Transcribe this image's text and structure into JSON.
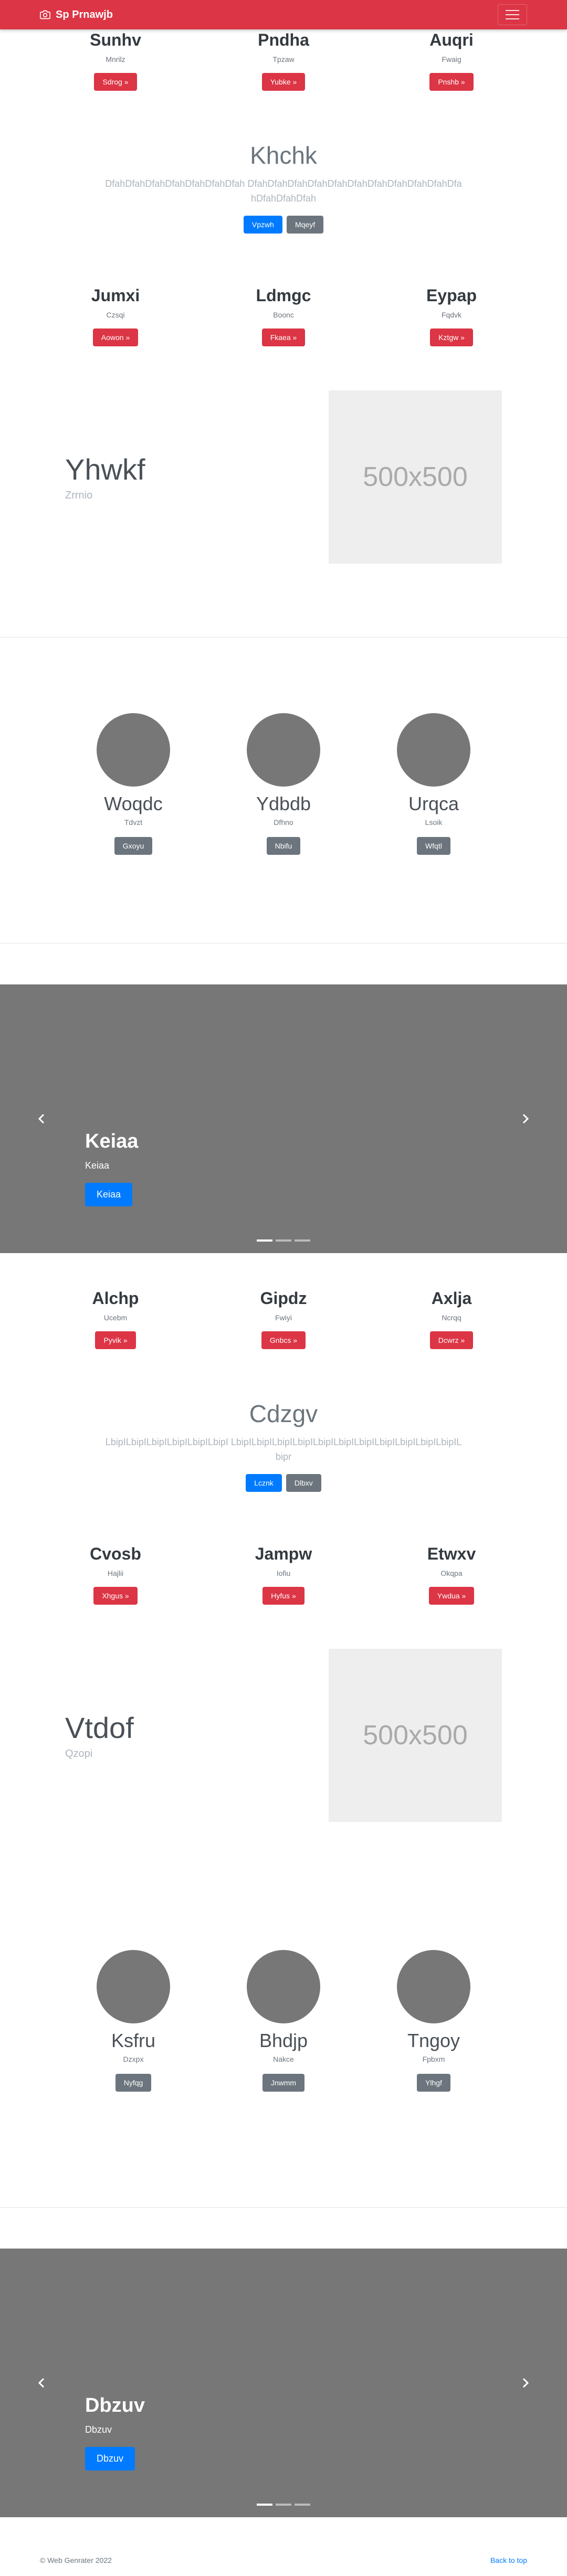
{
  "navbar": {
    "brand": "Sp Prnawjb",
    "brand_icon": "camera-icon"
  },
  "section1": {
    "cols": [
      {
        "title": "Sunhv",
        "sub": "Mnrilz",
        "btn": "Sdrog »"
      },
      {
        "title": "Pndha",
        "sub": "Tpzaw",
        "btn": "Yubke »"
      },
      {
        "title": "Auqri",
        "sub": "Fwaig",
        "btn": "Pnshb »"
      }
    ]
  },
  "jumbo1": {
    "title": "Khchk",
    "text": "DfahDfahDfahDfahDfahDfahDfah DfahDfahDfahDfahDfahDfahDfahDfahDfahDfahDfahDfahDfahDfah",
    "btn_primary": "Vpzwh",
    "btn_secondary": "Mqeyf"
  },
  "section2": {
    "cols": [
      {
        "title": "Jumxi",
        "sub": "Czsqi",
        "btn": "Aowon »"
      },
      {
        "title": "Ldmgc",
        "sub": "Boonc",
        "btn": "Fkaea »"
      },
      {
        "title": "Eypap",
        "sub": "Fqdvk",
        "btn": "Kztgw »"
      }
    ]
  },
  "feature1": {
    "title": "Yhwkf",
    "sub": "Zrrnio",
    "placeholder": "500x500"
  },
  "circles1": {
    "items": [
      {
        "name": "Woqdc",
        "sub": "Tdvzt",
        "btn": "Gxoyu"
      },
      {
        "name": "Ydbdb",
        "sub": "Dfhno",
        "btn": "Nbifu"
      },
      {
        "name": "Urqca",
        "sub": "Lsoik",
        "btn": "Wfqtl"
      }
    ]
  },
  "carousel1": {
    "title": "Keiaa",
    "sub": "Keiaa",
    "btn": "Keiaa"
  },
  "section3": {
    "cols": [
      {
        "title": "Alchp",
        "sub": "Ucebm",
        "btn": "Pyvik »"
      },
      {
        "title": "Gipdz",
        "sub": "Fwiyi",
        "btn": "Gnbcs »"
      },
      {
        "title": "Axlja",
        "sub": "Ncrqq",
        "btn": "Dcwrz »"
      }
    ]
  },
  "jumbo2": {
    "title": "Cdzgv",
    "text": "LbipILbipILbipILbipILbipILbipI LbipILbipILbipILbipILbipILbipILbipILbipILbipILbipILbipILbipr",
    "btn_primary": "Lcznk",
    "btn_secondary": "Dlbxv"
  },
  "section4": {
    "cols": [
      {
        "title": "Cvosb",
        "sub": "Hajlii",
        "btn": "Xhgus »"
      },
      {
        "title": "Jampw",
        "sub": "Iofiu",
        "btn": "Hyfus »"
      },
      {
        "title": "Etwxv",
        "sub": "Okqpa",
        "btn": "Ywdua »"
      }
    ]
  },
  "feature2": {
    "title": "Vtdof",
    "sub": "Qzopi",
    "placeholder": "500x500"
  },
  "circles2": {
    "items": [
      {
        "name": "Ksfru",
        "sub": "Dzxpx",
        "btn": "Nyfqg"
      },
      {
        "name": "Bhdjp",
        "sub": "Nakce",
        "btn": "Jnwmm"
      },
      {
        "name": "Tngoy",
        "sub": "Fpbxm",
        "btn": "Ylhgf"
      }
    ]
  },
  "carousel2": {
    "title": "Dbzuv",
    "sub": "Dbzuv",
    "btn": "Dbzuv"
  },
  "footer": {
    "copyright": "© Web Genrater 2022",
    "back_to_top": "Back to top"
  },
  "colors": {
    "primary_red": "#dc3545",
    "primary_blue": "#007bff",
    "gray_button": "#6c757d",
    "carousel_bg": "#777777"
  }
}
